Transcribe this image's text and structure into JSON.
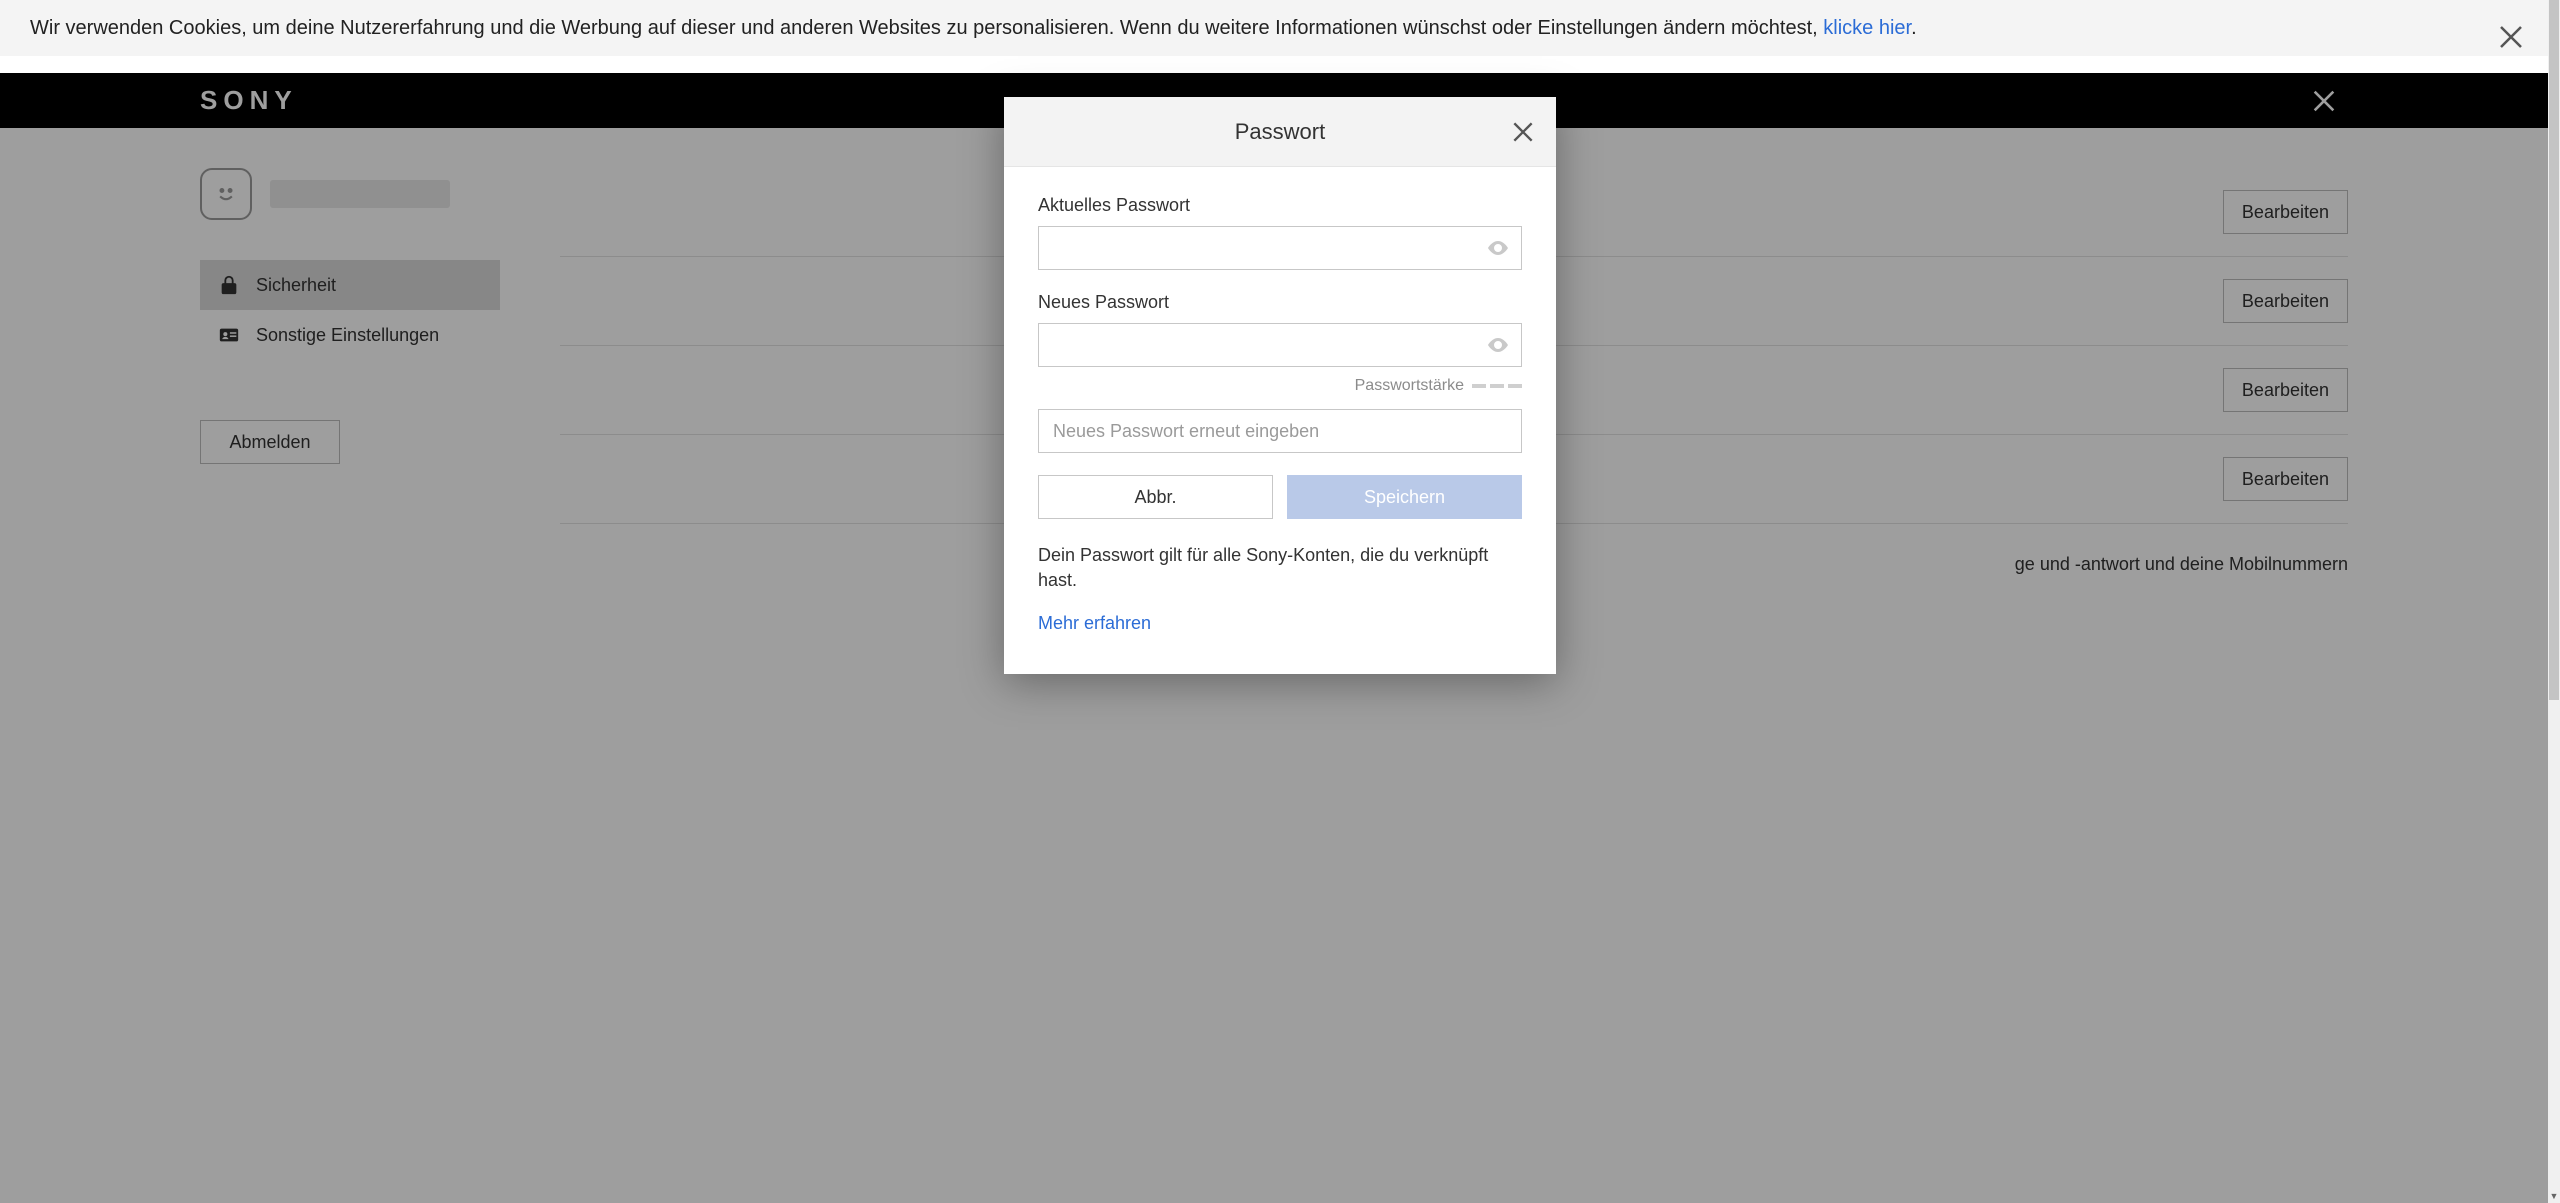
{
  "cookie": {
    "text_before": "Wir verwenden Cookies, um deine Nutzererfahrung und die Werbung auf dieser und anderen Websites zu personalisieren. Wenn du weitere Informationen wünschst oder Einstellungen ändern möchtest, ",
    "link": "klicke hier",
    "text_after": "."
  },
  "topbar": {
    "logo": "SONY"
  },
  "sidebar": {
    "items": [
      {
        "label": "Sicherheit"
      },
      {
        "label": "Sonstige Einstellungen"
      }
    ],
    "signout": "Abmelden"
  },
  "main": {
    "edit_label": "Bearbeiten",
    "info_line": "ge und -antwort und deine Mobilnummern"
  },
  "modal": {
    "title": "Passwort",
    "current_pw_label": "Aktuelles Passwort",
    "new_pw_label": "Neues Passwort",
    "strength_label": "Passwortstärke",
    "confirm_placeholder": "Neues Passwort erneut eingeben",
    "cancel": "Abbr.",
    "save": "Speichern",
    "note": "Dein Passwort gilt für alle Sony-Konten, die du verknüpft hast.",
    "learn_more": "Mehr erfahren"
  }
}
